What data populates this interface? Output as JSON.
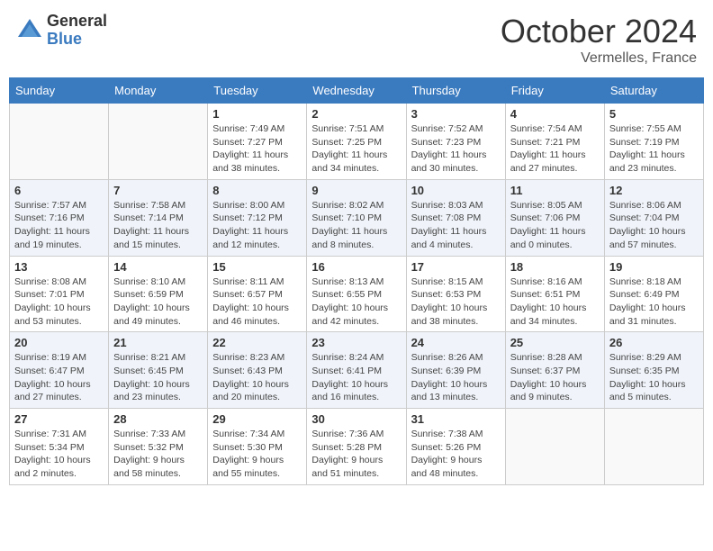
{
  "header": {
    "logo_general": "General",
    "logo_blue": "Blue",
    "month_title": "October 2024",
    "location": "Vermelles, France"
  },
  "days_of_week": [
    "Sunday",
    "Monday",
    "Tuesday",
    "Wednesday",
    "Thursday",
    "Friday",
    "Saturday"
  ],
  "weeks": [
    [
      {
        "day": "",
        "content": ""
      },
      {
        "day": "",
        "content": ""
      },
      {
        "day": "1",
        "content": "Sunrise: 7:49 AM\nSunset: 7:27 PM\nDaylight: 11 hours and 38 minutes."
      },
      {
        "day": "2",
        "content": "Sunrise: 7:51 AM\nSunset: 7:25 PM\nDaylight: 11 hours and 34 minutes."
      },
      {
        "day": "3",
        "content": "Sunrise: 7:52 AM\nSunset: 7:23 PM\nDaylight: 11 hours and 30 minutes."
      },
      {
        "day": "4",
        "content": "Sunrise: 7:54 AM\nSunset: 7:21 PM\nDaylight: 11 hours and 27 minutes."
      },
      {
        "day": "5",
        "content": "Sunrise: 7:55 AM\nSunset: 7:19 PM\nDaylight: 11 hours and 23 minutes."
      }
    ],
    [
      {
        "day": "6",
        "content": "Sunrise: 7:57 AM\nSunset: 7:16 PM\nDaylight: 11 hours and 19 minutes."
      },
      {
        "day": "7",
        "content": "Sunrise: 7:58 AM\nSunset: 7:14 PM\nDaylight: 11 hours and 15 minutes."
      },
      {
        "day": "8",
        "content": "Sunrise: 8:00 AM\nSunset: 7:12 PM\nDaylight: 11 hours and 12 minutes."
      },
      {
        "day": "9",
        "content": "Sunrise: 8:02 AM\nSunset: 7:10 PM\nDaylight: 11 hours and 8 minutes."
      },
      {
        "day": "10",
        "content": "Sunrise: 8:03 AM\nSunset: 7:08 PM\nDaylight: 11 hours and 4 minutes."
      },
      {
        "day": "11",
        "content": "Sunrise: 8:05 AM\nSunset: 7:06 PM\nDaylight: 11 hours and 0 minutes."
      },
      {
        "day": "12",
        "content": "Sunrise: 8:06 AM\nSunset: 7:04 PM\nDaylight: 10 hours and 57 minutes."
      }
    ],
    [
      {
        "day": "13",
        "content": "Sunrise: 8:08 AM\nSunset: 7:01 PM\nDaylight: 10 hours and 53 minutes."
      },
      {
        "day": "14",
        "content": "Sunrise: 8:10 AM\nSunset: 6:59 PM\nDaylight: 10 hours and 49 minutes."
      },
      {
        "day": "15",
        "content": "Sunrise: 8:11 AM\nSunset: 6:57 PM\nDaylight: 10 hours and 46 minutes."
      },
      {
        "day": "16",
        "content": "Sunrise: 8:13 AM\nSunset: 6:55 PM\nDaylight: 10 hours and 42 minutes."
      },
      {
        "day": "17",
        "content": "Sunrise: 8:15 AM\nSunset: 6:53 PM\nDaylight: 10 hours and 38 minutes."
      },
      {
        "day": "18",
        "content": "Sunrise: 8:16 AM\nSunset: 6:51 PM\nDaylight: 10 hours and 34 minutes."
      },
      {
        "day": "19",
        "content": "Sunrise: 8:18 AM\nSunset: 6:49 PM\nDaylight: 10 hours and 31 minutes."
      }
    ],
    [
      {
        "day": "20",
        "content": "Sunrise: 8:19 AM\nSunset: 6:47 PM\nDaylight: 10 hours and 27 minutes."
      },
      {
        "day": "21",
        "content": "Sunrise: 8:21 AM\nSunset: 6:45 PM\nDaylight: 10 hours and 23 minutes."
      },
      {
        "day": "22",
        "content": "Sunrise: 8:23 AM\nSunset: 6:43 PM\nDaylight: 10 hours and 20 minutes."
      },
      {
        "day": "23",
        "content": "Sunrise: 8:24 AM\nSunset: 6:41 PM\nDaylight: 10 hours and 16 minutes."
      },
      {
        "day": "24",
        "content": "Sunrise: 8:26 AM\nSunset: 6:39 PM\nDaylight: 10 hours and 13 minutes."
      },
      {
        "day": "25",
        "content": "Sunrise: 8:28 AM\nSunset: 6:37 PM\nDaylight: 10 hours and 9 minutes."
      },
      {
        "day": "26",
        "content": "Sunrise: 8:29 AM\nSunset: 6:35 PM\nDaylight: 10 hours and 5 minutes."
      }
    ],
    [
      {
        "day": "27",
        "content": "Sunrise: 7:31 AM\nSunset: 5:34 PM\nDaylight: 10 hours and 2 minutes."
      },
      {
        "day": "28",
        "content": "Sunrise: 7:33 AM\nSunset: 5:32 PM\nDaylight: 9 hours and 58 minutes."
      },
      {
        "day": "29",
        "content": "Sunrise: 7:34 AM\nSunset: 5:30 PM\nDaylight: 9 hours and 55 minutes."
      },
      {
        "day": "30",
        "content": "Sunrise: 7:36 AM\nSunset: 5:28 PM\nDaylight: 9 hours and 51 minutes."
      },
      {
        "day": "31",
        "content": "Sunrise: 7:38 AM\nSunset: 5:26 PM\nDaylight: 9 hours and 48 minutes."
      },
      {
        "day": "",
        "content": ""
      },
      {
        "day": "",
        "content": ""
      }
    ]
  ]
}
